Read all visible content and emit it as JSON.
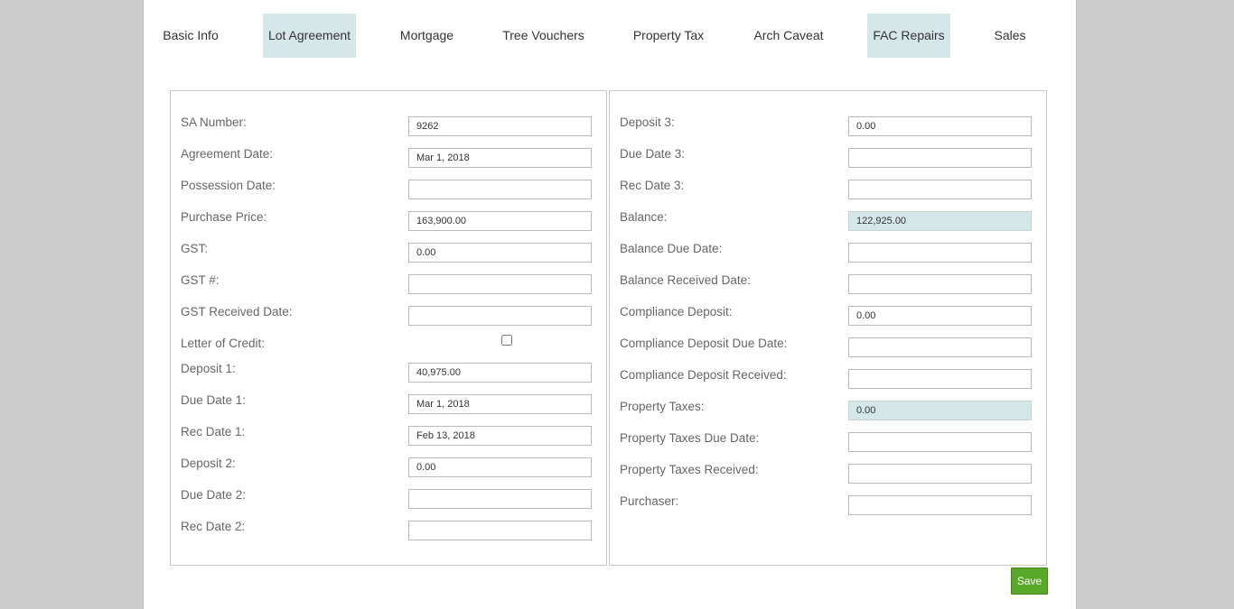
{
  "tabs": [
    {
      "label": "Basic Info",
      "highlighted": false
    },
    {
      "label": "Lot Agreement",
      "highlighted": true
    },
    {
      "label": "Mortgage",
      "highlighted": false
    },
    {
      "label": "Tree Vouchers",
      "highlighted": false
    },
    {
      "label": "Property Tax",
      "highlighted": false
    },
    {
      "label": "Arch Caveat",
      "highlighted": false
    },
    {
      "label": "FAC Repairs",
      "highlighted": true
    },
    {
      "label": "Sales",
      "highlighted": false
    }
  ],
  "left_fields": [
    {
      "label": "SA Number:",
      "value": "9262"
    },
    {
      "label": "Agreement Date:",
      "value": "Mar 1, 2018"
    },
    {
      "label": "Possession Date:",
      "value": ""
    },
    {
      "label": "Purchase Price:",
      "value": "163,900.00"
    },
    {
      "label": "GST:",
      "value": "0.00"
    },
    {
      "label": "GST #:",
      "value": ""
    },
    {
      "label": "GST Received Date:",
      "value": ""
    },
    {
      "label": "Letter of Credit:",
      "checked": false
    },
    {
      "label": "Deposit 1:",
      "value": "40,975.00"
    },
    {
      "label": "Due Date 1:",
      "value": "Mar 1, 2018"
    },
    {
      "label": "Rec Date 1:",
      "value": "Feb 13, 2018"
    },
    {
      "label": "Deposit 2:",
      "value": "0.00"
    },
    {
      "label": "Due Date 2:",
      "value": ""
    },
    {
      "label": "Rec Date 2:",
      "value": ""
    }
  ],
  "right_fields": [
    {
      "label": "Deposit 3:",
      "value": "0.00",
      "readonly": false
    },
    {
      "label": "Due Date 3:",
      "value": "",
      "readonly": false
    },
    {
      "label": "Rec Date 3:",
      "value": "",
      "readonly": false
    },
    {
      "label": "Balance:",
      "value": "122,925.00",
      "readonly": true
    },
    {
      "label": "Balance Due Date:",
      "value": "",
      "readonly": false
    },
    {
      "label": "Balance Received Date:",
      "value": "",
      "readonly": false
    },
    {
      "label": "Compliance Deposit:",
      "value": "0.00",
      "readonly": false
    },
    {
      "label": "Compliance Deposit Due Date:",
      "value": "",
      "readonly": false
    },
    {
      "label": "Compliance Deposit Received:",
      "value": "",
      "readonly": false
    },
    {
      "label": "Property Taxes:",
      "value": "0.00",
      "readonly": true
    },
    {
      "label": "Property Taxes Due Date:",
      "value": "",
      "readonly": false
    },
    {
      "label": "Property Taxes Received:",
      "value": "",
      "readonly": false
    },
    {
      "label": "Purchaser:",
      "value": "",
      "readonly": false
    }
  ],
  "save_label": "Save",
  "colors": {
    "highlight": "#d6e7ea",
    "save": "#5aa82a"
  }
}
